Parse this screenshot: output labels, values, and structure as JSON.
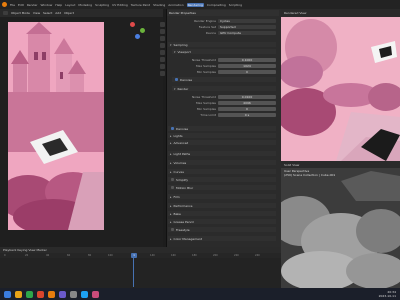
{
  "menubar": {
    "items": [
      "File",
      "Edit",
      "Render",
      "Window",
      "Help"
    ],
    "workspaces": [
      "Layout",
      "Modeling",
      "Sculpting",
      "UV Editing",
      "Texture Paint",
      "Shading",
      "Animation",
      "Rendering",
      "Compositing",
      "Scripting"
    ],
    "active_workspace": "Rendering"
  },
  "left_viewport": {
    "header_label": "Camera Perspective",
    "modes": [
      "Object Mode",
      "View",
      "Select",
      "Add",
      "Object"
    ]
  },
  "properties": {
    "title": "Render Properties",
    "render_engine_label": "Render Engine",
    "render_engine": "Cycles",
    "feature_set_label": "Feature Set",
    "feature_set": "Supported",
    "device_label": "Device",
    "device": "GPU Compute",
    "sampling_label": "Sampling",
    "viewport_label": "Viewport",
    "noise_threshold_label": "Noise Threshold",
    "noise_threshold": "0.1000",
    "max_samples_label": "Max Samples",
    "max_samples": "1024",
    "min_samples_label": "Min Samples",
    "min_samples": "0",
    "denoise_label": "Denoise",
    "render_label": "Render",
    "r_noise_threshold": "0.0100",
    "r_max_samples": "4096",
    "r_min_samples": "0",
    "time_limit_label": "Time Limit",
    "time_limit": "0 s",
    "sections": [
      "Denoise",
      "Lights",
      "Advanced",
      "Light Paths",
      "Volumes",
      "Curves",
      "Simplify",
      "Motion Blur",
      "Film",
      "Performance",
      "Bake",
      "Grease Pencil",
      "Freestyle",
      "Color Management"
    ]
  },
  "right_top": {
    "header_label": "Rendered View"
  },
  "right_bottom": {
    "header_label": "Solid View",
    "info_line1": "User Perspective",
    "info_line2": "(250) Scene Collection | Cube.001"
  },
  "timeline": {
    "header_label": "Playback  Keying  View  Marker",
    "ticks": [
      "0",
      "20",
      "40",
      "60",
      "80",
      "100",
      "120",
      "140",
      "160",
      "180",
      "200",
      "220",
      "240"
    ],
    "current_frame": "1"
  },
  "taskbar": {
    "time": "20:34",
    "date": "2023-10-11"
  },
  "colors": {
    "accent": "#4772b3",
    "brand": "#e87d0d",
    "panel_bg": "#2b2b2b",
    "pink_scene": "#e88fb2"
  }
}
